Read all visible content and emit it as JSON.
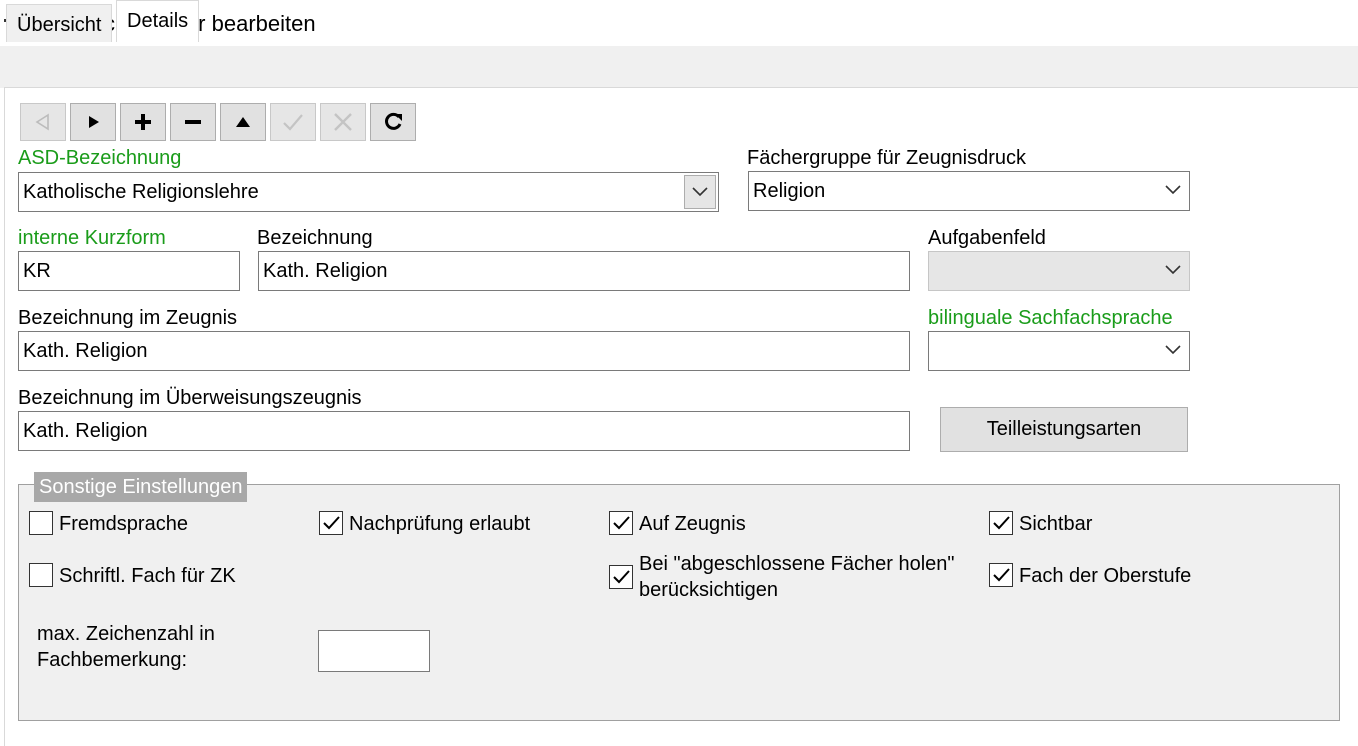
{
  "window": {
    "title": "Unterrichtsfächer bearbeiten",
    "icon": "window-app-icon"
  },
  "tabs": [
    {
      "label": "Übersicht",
      "active": false
    },
    {
      "label": "Details",
      "active": true
    }
  ],
  "toolbar": {
    "buttons": [
      {
        "name": "first-record",
        "icon": "triangle-left-icon",
        "enabled": false
      },
      {
        "name": "next-record",
        "icon": "triangle-right-icon",
        "enabled": true
      },
      {
        "name": "add-record",
        "icon": "plus-icon",
        "enabled": true
      },
      {
        "name": "delete-record",
        "icon": "minus-icon",
        "enabled": true
      },
      {
        "name": "edit-record",
        "icon": "triangle-up-icon",
        "enabled": true
      },
      {
        "name": "save-record",
        "icon": "check-icon",
        "enabled": false
      },
      {
        "name": "cancel-record",
        "icon": "x-icon",
        "enabled": false
      },
      {
        "name": "refresh-record",
        "icon": "refresh-icon",
        "enabled": true
      }
    ]
  },
  "form": {
    "asd_label": "ASD-Bezeichnung",
    "asd_value": "Katholische Religionslehre",
    "faechergruppe_label": "Fächergruppe für Zeugnisdruck",
    "faechergruppe_value": "Religion",
    "kurzform_label": "interne Kurzform",
    "kurzform_value": "KR",
    "bezeichnung_label": "Bezeichnung",
    "bezeichnung_value": "Kath. Religion",
    "aufgabenfeld_label": "Aufgabenfeld",
    "aufgabenfeld_value": "",
    "zeugnis_label": "Bezeichnung im Zeugnis",
    "zeugnis_value": "Kath. Religion",
    "bilingual_label": "bilinguale Sachfachsprache",
    "bilingual_value": "",
    "ueberweisung_label": "Bezeichnung im Überweisungszeugnis",
    "ueberweisung_value": "Kath. Religion",
    "teilleistung_button": "Teilleistungsarten"
  },
  "settings": {
    "caption": "Sonstige Einstellungen",
    "fremdsprache": {
      "label": "Fremdsprache",
      "checked": false
    },
    "schriftl": {
      "label": "Schriftl. Fach für ZK",
      "checked": false
    },
    "nachpruefung": {
      "label": "Nachprüfung erlaubt",
      "checked": true
    },
    "auf_zeugnis": {
      "label": "Auf Zeugnis",
      "checked": true
    },
    "abgeschlossene_line1": "Bei \"abgeschlossene Fächer holen\"",
    "abgeschlossene_line2": "berücksichtigen",
    "abgeschlossene_checked": true,
    "sichtbar": {
      "label": "Sichtbar",
      "checked": true
    },
    "oberstufe": {
      "label": "Fach der Oberstufe",
      "checked": true
    },
    "zeichenzahl_line1": "max. Zeichenzahl in",
    "zeichenzahl_line2": "Fachbemerkung:",
    "zeichenzahl_value": ""
  },
  "colors": {
    "required_label": "#1a9c1a",
    "caption_bg": "#a8a8a8",
    "group_bg": "#f0f0f0"
  }
}
